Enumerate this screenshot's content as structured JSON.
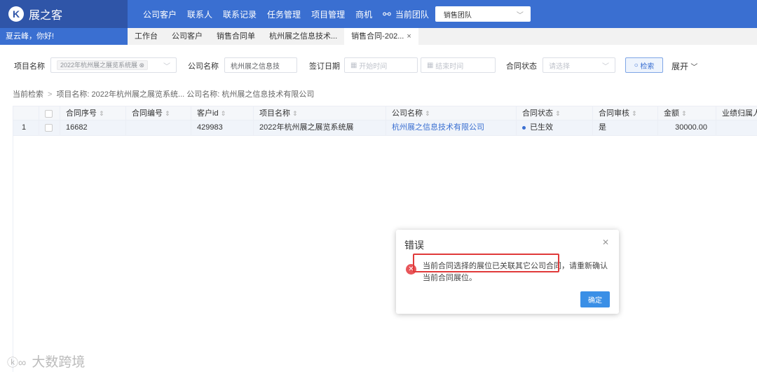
{
  "brand": {
    "name": "展之客"
  },
  "topnav": [
    "公司客户",
    "联系人",
    "联系记录",
    "任务管理",
    "项目管理",
    "商机"
  ],
  "team": {
    "label": "当前团队",
    "selected": "销售团队"
  },
  "greeting": "夏云峰，你好!",
  "tabs": [
    "工作台",
    "公司客户",
    "销售合同单",
    "杭州展之信息技术...",
    "销售合同-202..."
  ],
  "filters": {
    "project_label": "项目名称",
    "project_tag": "2022年杭州展之展览系统展",
    "company_label": "公司名称",
    "company_value": "杭州展之信息技",
    "date_label": "签订日期",
    "start_placeholder": "开始时间",
    "end_placeholder": "结束时间",
    "status_label": "合同状态",
    "status_placeholder": "请选择",
    "search_label": "检索",
    "expand_label": "展开"
  },
  "breadcrumb": {
    "root": "当前检索",
    "criteria": "项目名称: 2022年杭州展之展览系统...   公司名称: 杭州展之信息技术有限公司"
  },
  "table": {
    "headers": [
      "合同序号",
      "合同编号",
      "客户id",
      "项目名称",
      "公司名称",
      "合同状态",
      "合同审核",
      "金额",
      "业绩归属人"
    ],
    "rows": [
      {
        "index": "1",
        "seq": "16682",
        "code": "",
        "customer_id": "429983",
        "project": "2022年杭州展之展览系统展",
        "company": "杭州展之信息技术有限公司",
        "status": "已生效",
        "audit": "是",
        "amount": "30000.00",
        "owner": ""
      }
    ]
  },
  "dialog": {
    "title": "错误",
    "message": "当前合同选择的展位已关联其它公司合同，请重新确认当前合同展位。",
    "ok_label": "确定"
  },
  "watermark": {
    "text": "大数跨境"
  },
  "colors": {
    "primary": "#3a6fd1",
    "brand_dark": "#2f55a8",
    "error": "#e8565a",
    "highlight": "#e03a3a"
  }
}
